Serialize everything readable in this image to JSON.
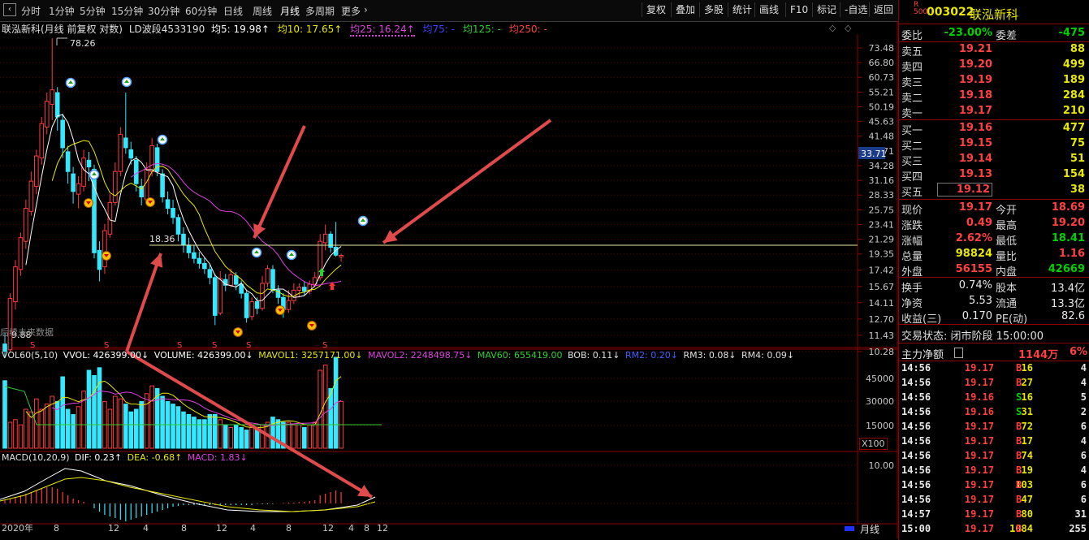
{
  "toolbar": {
    "back_icon": "back-icon",
    "periods": [
      "分时",
      "1分钟",
      "5分钟",
      "15分钟",
      "30分钟",
      "60分钟",
      "日线",
      "周线",
      "月线",
      "多周期",
      "更多"
    ],
    "right_buttons": [
      "复权",
      "叠加",
      "多股",
      "统计",
      "画线",
      "F10",
      "标记",
      "-自选",
      "返回"
    ]
  },
  "chart_header": {
    "name": "联泓新科(月线 前复权 对数)",
    "ld": "LD波段4533190",
    "ma5": "均5: 19.98↑",
    "ma10": "均10: 17.65↑",
    "ma25": "均25: 16.24↑",
    "ma75": "均75: -",
    "ma125": "均125: -",
    "ma250": "均250: -"
  },
  "price_labels": {
    "high": "78.26",
    "low": "9.88",
    "level": "18.36",
    "current_axis": "33.71",
    "no_data": "后续未来数据"
  },
  "price_axis": [
    "73.48",
    "66.80",
    "60.73",
    "55.21",
    "50.19",
    "45.63",
    "41.48",
    "37.71",
    "34.28",
    "31.16",
    "28.33",
    "25.75",
    "23.41",
    "21.29",
    "19.35",
    "17.42",
    "15.67",
    "14.11",
    "12.70",
    "11.43",
    "10.28"
  ],
  "vol_header": {
    "name": "VOL60(5,10)",
    "vvol": "VVOL: 426399.00↓",
    "volume": "VOLUME: 426399.00↓",
    "mavol1": "MAVOL1: 3257171.00↓",
    "mavol2": "MAVOL2: 2248498.75↓",
    "mav60": "MAV60: 655419.00",
    "bob": "BOB: 0.11↓",
    "rm2": "RM2: 0.20↓",
    "rm3": "RM3: 0.08↓",
    "rm4": "RM4: 0.09↓"
  },
  "vol_axis": [
    "45000",
    "30000",
    "15000"
  ],
  "vol_unit": "X100",
  "macd_header": {
    "name": "MACD(10,20,9)",
    "dif": "DIF: 0.23↑",
    "dea": "DEA: -0.68↑",
    "macd": "MACD: 1.83↓"
  },
  "macd_axis": [
    "10.00"
  ],
  "x_axis": [
    "2020年",
    "8",
    "12",
    "4",
    "8",
    "12",
    "4",
    "8",
    "12",
    "4",
    "8",
    "12"
  ],
  "bottom_period": "月线",
  "quote": {
    "code": "003022",
    "name": "联泓新科",
    "weibi_label": "委比",
    "weibi": "-23.00%",
    "weicha_label": "委差",
    "weicha": "-475",
    "asks": [
      {
        "label": "卖五",
        "price": "19.21",
        "vol": "88"
      },
      {
        "label": "卖四",
        "price": "19.20",
        "vol": "499"
      },
      {
        "label": "卖三",
        "price": "19.19",
        "vol": "189"
      },
      {
        "label": "卖二",
        "price": "19.18",
        "vol": "284"
      },
      {
        "label": "卖一",
        "price": "19.17",
        "vol": "210"
      }
    ],
    "bids": [
      {
        "label": "买一",
        "price": "19.16",
        "vol": "477"
      },
      {
        "label": "买二",
        "price": "19.15",
        "vol": "75"
      },
      {
        "label": "买三",
        "price": "19.14",
        "vol": "51"
      },
      {
        "label": "买四",
        "price": "19.13",
        "vol": "154"
      },
      {
        "label": "买五",
        "price": "19.12",
        "vol": "38"
      }
    ],
    "stats": [
      {
        "l1": "现价",
        "v1": "19.17",
        "c1": "red",
        "l2": "今开",
        "v2": "18.69",
        "c2": "red"
      },
      {
        "l1": "涨跌",
        "v1": "0.49",
        "c1": "red",
        "l2": "最高",
        "v2": "19.20",
        "c2": "red"
      },
      {
        "l1": "涨幅",
        "v1": "2.62%",
        "c1": "red",
        "l2": "最低",
        "v2": "18.41",
        "c2": "grn"
      },
      {
        "l1": "总量",
        "v1": "98824",
        "c1": "yel",
        "l2": "量比",
        "v2": "1.16",
        "c2": "red"
      },
      {
        "l1": "外盘",
        "v1": "56155",
        "c1": "red",
        "l2": "内盘",
        "v2": "42669",
        "c2": "grn"
      }
    ],
    "stats2": [
      {
        "l1": "换手",
        "v1": "0.74%",
        "l2": "股本",
        "v2": "13.4亿"
      },
      {
        "l1": "净资",
        "v1": "5.53",
        "l2": "流通",
        "v2": "13.3亿"
      },
      {
        "l1": "收益(三)",
        "v1": "0.170",
        "l2": "PE(动)",
        "v2": "82.6"
      }
    ],
    "status": "交易状态: 闭市阶段 15:00:00",
    "capital_label": "主力净额",
    "capital_value": "1144万",
    "capital_pct": "6%"
  },
  "ticks": [
    {
      "t": "14:56",
      "p": "19.17",
      "v": "16",
      "d": "B",
      "n": "4"
    },
    {
      "t": "14:56",
      "p": "19.17",
      "v": "27",
      "d": "B",
      "n": "4"
    },
    {
      "t": "14:56",
      "p": "19.16",
      "v": "16",
      "d": "S",
      "n": "5"
    },
    {
      "t": "14:56",
      "p": "19.16",
      "v": "31",
      "d": "S",
      "n": "2"
    },
    {
      "t": "14:56",
      "p": "19.17",
      "v": "72",
      "d": "B",
      "n": "6"
    },
    {
      "t": "14:56",
      "p": "19.17",
      "v": "17",
      "d": "B",
      "n": "4"
    },
    {
      "t": "14:56",
      "p": "19.17",
      "v": "74",
      "d": "B",
      "n": "6"
    },
    {
      "t": "14:56",
      "p": "19.17",
      "v": "19",
      "d": "B",
      "n": "4"
    },
    {
      "t": "14:56",
      "p": "19.17",
      "v": "103",
      "d": "B",
      "n": "6"
    },
    {
      "t": "14:56",
      "p": "19.17",
      "v": "47",
      "d": "B",
      "n": "6"
    },
    {
      "t": "14:57",
      "p": "19.17",
      "v": "80",
      "d": "B",
      "n": "31"
    },
    {
      "t": "15:00",
      "p": "19.17",
      "v": "1084",
      "d": "B",
      "n": "255"
    }
  ]
}
